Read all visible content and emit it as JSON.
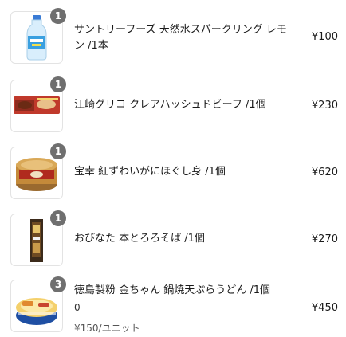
{
  "cart": {
    "items": [
      {
        "name": "サントリーフーズ 天然水スパークリング レモン /1本",
        "quantity": "1",
        "price": "¥100",
        "image": "sparkling-water-bottle"
      },
      {
        "name": "江崎グリコ クレアハッシュドビーフ /1個",
        "quantity": "1",
        "price": "¥230",
        "image": "hashed-beef-box"
      },
      {
        "name": "宝幸 紅ずわいがにほぐし身 /1個",
        "quantity": "1",
        "price": "¥620",
        "image": "crab-can"
      },
      {
        "name": "おびなた 本とろろそば /1個",
        "quantity": "1",
        "price": "¥270",
        "image": "soba-pack"
      },
      {
        "name": "徳島製粉 金ちゃん 鍋焼天ぷらうどん /1個",
        "quantity": "3",
        "price": "¥450",
        "sub_value": "0",
        "unit_price": "¥150/ユニット",
        "image": "udon-bowl"
      }
    ]
  }
}
